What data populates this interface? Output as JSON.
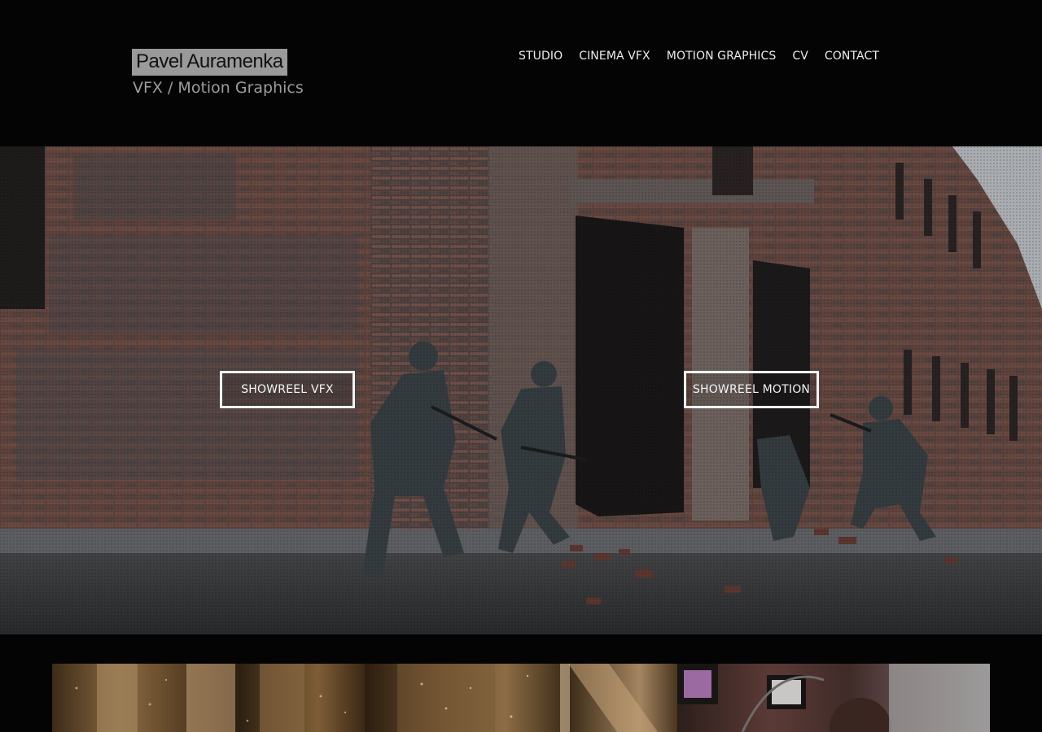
{
  "header": {
    "logo_name": "Pavel Auramenka",
    "logo_subtitle": "VFX / Motion Graphics",
    "nav": [
      {
        "label": "STUDIO"
      },
      {
        "label": "CINEMA VFX"
      },
      {
        "label": "MOTION GRAPHICS"
      },
      {
        "label": "CV"
      },
      {
        "label": "CONTACT"
      }
    ]
  },
  "hero": {
    "image": "war-scene-soldiers-brick-ruins",
    "buttons": [
      {
        "label": "SHOWREEL VFX"
      },
      {
        "label": "SHOWREEL MOTION"
      }
    ]
  },
  "thumbnails": [
    {
      "image": "ornate-golden-interior"
    },
    {
      "image": "sparks-wooden-structure"
    },
    {
      "image": "retro-tv-monitors"
    }
  ],
  "colors": {
    "background": "#040404",
    "logo_bg": "#9a9a9a",
    "text": "#ededed"
  }
}
